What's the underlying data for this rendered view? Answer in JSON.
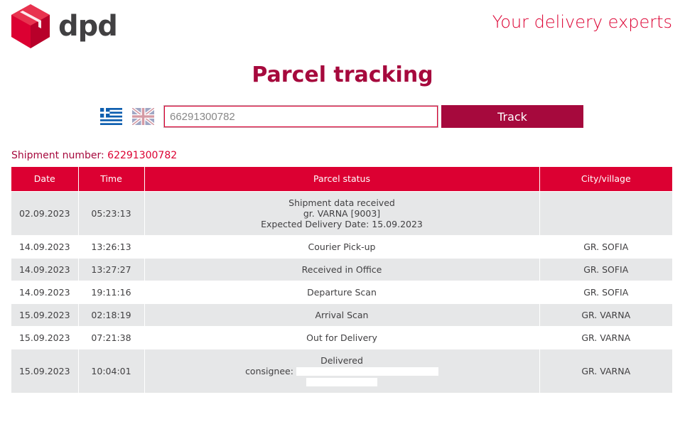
{
  "header": {
    "logo_text": "dpd",
    "tagline": "Your delivery experts",
    "brand_color": "#dc0032",
    "brand_dark": "#a6093d"
  },
  "page": {
    "title": "Parcel tracking"
  },
  "search": {
    "flags": [
      "greek-flag-icon",
      "uk-flag-icon"
    ],
    "input_value": "66291300782",
    "button_label": "Track"
  },
  "shipment": {
    "label": "Shipment number: ",
    "number": "62291300782"
  },
  "table": {
    "headers": [
      "Date",
      "Time",
      "Parcel status",
      "City/village"
    ],
    "rows": [
      {
        "date": "02.09.2023",
        "time": "05:23:13",
        "status": [
          "Shipment data received",
          "gr. VARNA [9003]",
          "Expected Delivery Date: 15.09.2023"
        ],
        "city": ""
      },
      {
        "date": "14.09.2023",
        "time": "13:26:13",
        "status": [
          "Courier Pick-up"
        ],
        "city": "GR. SOFIA"
      },
      {
        "date": "14.09.2023",
        "time": "13:27:27",
        "status": [
          "Received in Office"
        ],
        "city": "GR. SOFIA"
      },
      {
        "date": "14.09.2023",
        "time": "19:11:16",
        "status": [
          "Departure Scan"
        ],
        "city": "GR. SOFIA"
      },
      {
        "date": "15.09.2023",
        "time": "02:18:19",
        "status": [
          "Arrival Scan"
        ],
        "city": "GR. VARNA"
      },
      {
        "date": "15.09.2023",
        "time": "07:21:38",
        "status": [
          "Out for Delivery"
        ],
        "city": "GR. VARNA"
      },
      {
        "date": "15.09.2023",
        "time": "10:04:01",
        "status": [
          "Delivered",
          "consignee:"
        ],
        "city": "GR. VARNA"
      }
    ]
  }
}
